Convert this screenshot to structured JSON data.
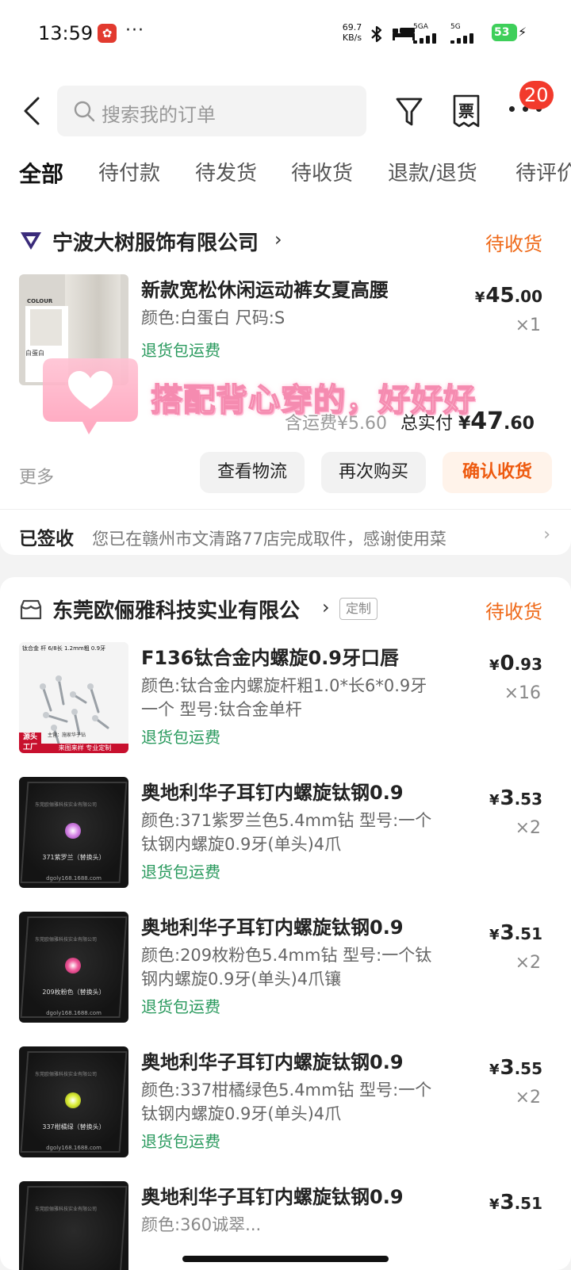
{
  "status_bar": {
    "time": "13:59",
    "more": "···",
    "net_speed": "69.7",
    "net_unit": "KB/s",
    "sim1": "5GA",
    "sim2": "5G",
    "battery": "53"
  },
  "header": {
    "search_placeholder": "搜索我的订单",
    "invoice_label": "票",
    "badge": "20"
  },
  "tabs": [
    "全部",
    "待付款",
    "待发货",
    "待收货",
    "退款/退货",
    "待评价"
  ],
  "order1": {
    "store": "宁波大树服饰有限公司",
    "status": "待收货",
    "item": {
      "title": "新款宽松休闲运动裤女夏高腰",
      "spec": "颜色:白蛋白 尺码:S",
      "ship": "退货包运费",
      "price_int": "45",
      "price_dec": ".00",
      "qty": "×1",
      "thumb_tag": "COLOUR",
      "thumb_color": "白蛋白"
    },
    "shipping": "含运费¥5.60",
    "total_label": "总实付",
    "total_int": "47",
    "total_dec": ".60",
    "more": "更多",
    "btn_logistics": "查看物流",
    "btn_rebuy": "再次购买",
    "btn_confirm": "确认收货",
    "sign_label": "已签收",
    "sign_text": "您已在赣州市文清路77店完成取件，感谢使用菜"
  },
  "overlay_text": "搭配背心穿的，好好好",
  "order2": {
    "store": "东莞欧俪雅科技实业有限公",
    "tag": "定制",
    "status": "待收货",
    "items": [
      {
        "title": "F136钛合金内螺旋0.9牙口唇",
        "spec": "颜色:钛合金内螺旋杆粗1.0*长6*0.9牙一个 型号:钛合金单杆",
        "ship": "退货包运费",
        "price_int": "0",
        "price_dec": ".93",
        "qty": "×16",
        "thumb_header": "钛合金 杆 6/8长 1.2mm粗 0.9牙",
        "thumb_badge1": "源头",
        "thumb_badge2": "工厂",
        "thumb_footer": "来图来样 专业定制",
        "thumb_note": "主营：施家华子钻"
      },
      {
        "title": "奥地利华子耳钉内螺旋钛钢0.9",
        "spec": "颜色:371紫罗兰色5.4mm钻 型号:一个钛钢内螺旋0.9牙(单头)4爪",
        "ship": "退货包运费",
        "price_int": "3",
        "price_dec": ".53",
        "qty": "×2",
        "gem": "#d88ae8",
        "gem_label": "371紫罗兰（替换头）"
      },
      {
        "title": "奥地利华子耳钉内螺旋钛钢0.9",
        "spec": "颜色:209枚粉色5.4mm钻 型号:一个钛钢内螺旋0.9牙(单头)4爪镶",
        "ship": "退货包运费",
        "price_int": "3",
        "price_dec": ".51",
        "qty": "×2",
        "gem": "#f05a9a",
        "gem_label": "209枚粉色（替换头）"
      },
      {
        "title": "奥地利华子耳钉内螺旋钛钢0.9",
        "spec": "颜色:337柑橘绿色5.4mm钻 型号:一个钛钢内螺旋0.9牙(单头)4爪",
        "ship": "退货包运费",
        "price_int": "3",
        "price_dec": ".55",
        "qty": "×2",
        "gem": "#dcee3a",
        "gem_label": "337柑橘绿（替换头）"
      },
      {
        "title": "奥地利华子耳钉内螺旋钛钢0.9",
        "spec": "颜色:360诚翠...",
        "ship": "",
        "price_int": "3",
        "price_dec": ".51",
        "qty": "",
        "gem": "#3ab58a",
        "gem_label": ""
      }
    ],
    "thumb_site": "dgoly168.1688.com",
    "thumb_company": "东莞欧俪雅科技实业有限公司"
  },
  "currency": "¥"
}
